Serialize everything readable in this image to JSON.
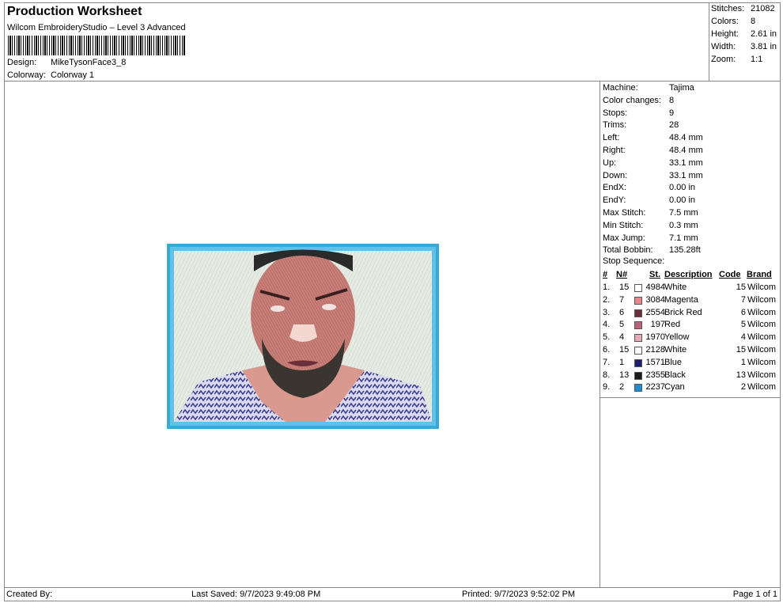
{
  "header": {
    "title": "Production Worksheet",
    "subtitle": "Wilcom EmbroideryStudio – Level 3 Advanced",
    "design_label": "Design:",
    "design_value": "MikeTysonFace3_8",
    "colorway_label": "Colorway:",
    "colorway_value": "Colorway 1"
  },
  "summary": [
    {
      "label": "Stitches:",
      "value": "21082"
    },
    {
      "label": "Colors:",
      "value": "8"
    },
    {
      "label": "Height:",
      "value": "2.61 in"
    },
    {
      "label": "Width:",
      "value": "3.81 in"
    },
    {
      "label": "Zoom:",
      "value": "1:1"
    }
  ],
  "machine": [
    {
      "label": "Machine:",
      "value": "Tajima"
    },
    {
      "label": "Color changes:",
      "value": "8"
    },
    {
      "label": "Stops:",
      "value": "9"
    },
    {
      "label": "Trims:",
      "value": "28"
    },
    {
      "label": "Left:",
      "value": "48.4 mm"
    },
    {
      "label": "Right:",
      "value": "48.4 mm"
    },
    {
      "label": "Up:",
      "value": "33.1 mm"
    },
    {
      "label": "Down:",
      "value": "33.1 mm"
    },
    {
      "label": "EndX:",
      "value": "0.00 in"
    },
    {
      "label": "EndY:",
      "value": "0.00 in"
    },
    {
      "label": "Max Stitch:",
      "value": "7.5 mm"
    },
    {
      "label": "Min Stitch:",
      "value": "0.3 mm"
    },
    {
      "label": "Max Jump:",
      "value": "7.1 mm"
    },
    {
      "label": "Total Bobbin:",
      "value": "135.28ft"
    }
  ],
  "stop_sequence": {
    "title": "Stop Sequence:",
    "columns": {
      "num": "#",
      "needle": "N#",
      "stitches": "St.",
      "description": "Description",
      "code": "Code",
      "brand": "Brand"
    },
    "rows": [
      {
        "num": "1.",
        "needle": "15",
        "color": "#ffffff",
        "stitches": "4984",
        "description": "White",
        "code": "15",
        "brand": "Wilcom"
      },
      {
        "num": "2.",
        "needle": "7",
        "color": "#e8868a",
        "stitches": "3084",
        "description": "Magenta",
        "code": "7",
        "brand": "Wilcom"
      },
      {
        "num": "3.",
        "needle": "6",
        "color": "#6b2e3c",
        "stitches": "2554",
        "description": "Brick Red",
        "code": "6",
        "brand": "Wilcom"
      },
      {
        "num": "4.",
        "needle": "5",
        "color": "#c0607a",
        "stitches": "197",
        "description": "Red",
        "code": "5",
        "brand": "Wilcom"
      },
      {
        "num": "5.",
        "needle": "4",
        "color": "#e8aab6",
        "stitches": "1970",
        "description": "Yellow",
        "code": "4",
        "brand": "Wilcom"
      },
      {
        "num": "6.",
        "needle": "15",
        "color": "#ffffff",
        "stitches": "2128",
        "description": "White",
        "code": "15",
        "brand": "Wilcom"
      },
      {
        "num": "7.",
        "needle": "1",
        "color": "#1e1e6e",
        "stitches": "1571",
        "description": "Blue",
        "code": "1",
        "brand": "Wilcom"
      },
      {
        "num": "8.",
        "needle": "13",
        "color": "#1a1a1a",
        "stitches": "2355",
        "description": "Black",
        "code": "13",
        "brand": "Wilcom"
      },
      {
        "num": "9.",
        "needle": "2",
        "color": "#1e8fd0",
        "stitches": "2237",
        "description": "Cyan",
        "code": "2",
        "brand": "Wilcom"
      }
    ]
  },
  "footer": {
    "created_by": "Created By:",
    "last_saved": "Last Saved: 9/7/2023 9:49:08 PM",
    "printed": "Printed: 9/7/2023 9:52:02 PM",
    "page": "Page 1 of 1"
  }
}
